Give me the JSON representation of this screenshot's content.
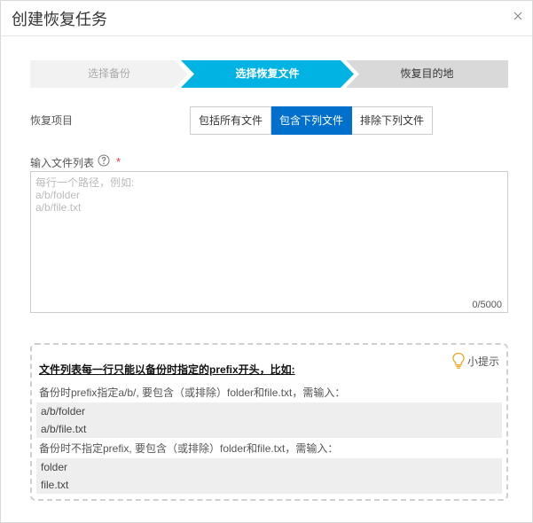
{
  "dialog": {
    "title": "创建恢复任务"
  },
  "steps": [
    {
      "label": "选择备份",
      "state": "done"
    },
    {
      "label": "选择恢复文件",
      "state": "current"
    },
    {
      "label": "恢复目的地",
      "state": "todo"
    }
  ],
  "restore_scope": {
    "label": "恢复项目",
    "options": [
      "包括所有文件",
      "包含下列文件",
      "排除下列文件"
    ],
    "selected": "包含下列文件"
  },
  "file_list": {
    "label": "输入文件列表",
    "required_mark": "*",
    "placeholder": "每行一个路径，例如:\na/b/folder\na/b/file.txt",
    "value": "",
    "counter": "0/5000"
  },
  "tip": {
    "badge": "小提示",
    "heading": "文件列表每一行只能以备份时指定的prefix开头，比如:",
    "line1": "备份时prefix指定a/b/, 要包含（或排除）folder和file.txt，需输入：",
    "code1": [
      "a/b/folder",
      "a/b/file.txt"
    ],
    "line2": "备份时不指定prefix, 要包含（或排除）folder和file.txt，需输入：",
    "code2": [
      "folder",
      "file.txt"
    ]
  },
  "colors": {
    "primary": "#0070cc",
    "step_active": "#00b3e3",
    "step_idle": "#f2f2f2",
    "step_todo": "#d9d9d9"
  }
}
